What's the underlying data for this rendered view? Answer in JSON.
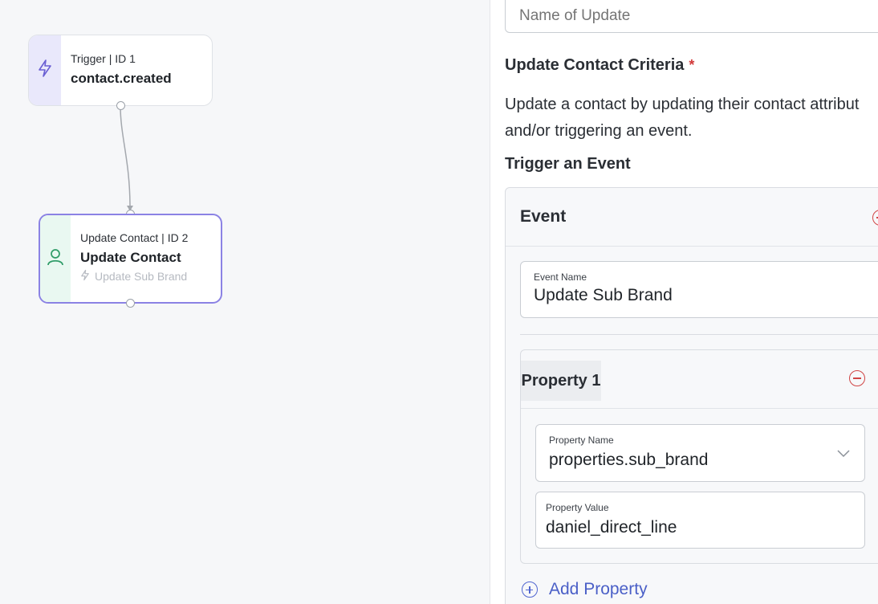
{
  "canvas": {
    "trigger_node": {
      "kicker": "Trigger | ID 1",
      "name": "contact.created",
      "icon": "lightning-icon"
    },
    "update_node": {
      "kicker": "Update Contact | ID 2",
      "name": "Update Contact",
      "subtitle": "Update Sub Brand",
      "icon": "person-icon"
    }
  },
  "panel": {
    "name_input": {
      "placeholder": "Name of Update",
      "value": ""
    },
    "criteria": {
      "title": "Update Contact Criteria",
      "required_mark": "*",
      "description_line1": "Update a contact by updating their contact attribut",
      "description_line2": "and/or triggering an event."
    },
    "trigger_section": {
      "title": "Trigger an Event",
      "event": {
        "label": "Event",
        "event_name_label": "Event Name",
        "event_name_value": "Update Sub Brand",
        "property": {
          "label": "Property 1",
          "name_label": "Property Name",
          "name_value": "properties.sub_brand",
          "value_label": "Property Value",
          "value_value": "daniel_direct_line"
        },
        "add_property_label": "Add Property"
      }
    }
  },
  "colors": {
    "accent": "#8b82e4",
    "link": "#4a5fc7",
    "danger": "#d04545",
    "trigger_strip": "#e9e8fb",
    "contact_strip": "#e9f8f1",
    "contact_icon": "#2f9c68"
  }
}
